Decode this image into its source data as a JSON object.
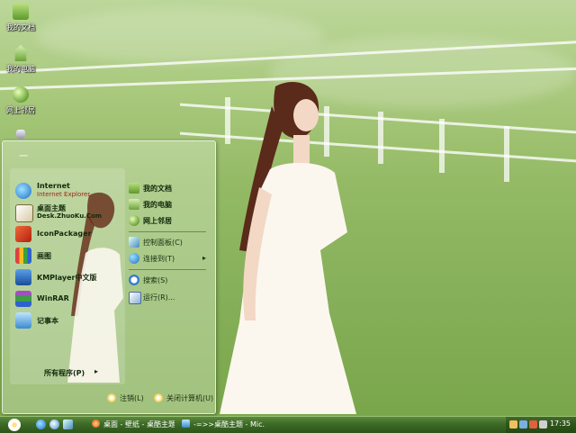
{
  "desktop": {
    "icons": [
      {
        "label": "我的文档",
        "icon": "folder-icon"
      },
      {
        "label": "我的电脑",
        "icon": "home-icon"
      },
      {
        "label": "网上邻居",
        "icon": "globe-icon"
      },
      {
        "label": "",
        "icon": "recycle-bin-icon"
      }
    ]
  },
  "start_menu": {
    "user_name": "一",
    "programs": [
      {
        "title": "Internet",
        "subtitle": "Internet Explorer",
        "icon": "internet-explorer-icon"
      },
      {
        "title": "桌面主题",
        "subtitle": "Desk.ZhuoKu.Com",
        "icon": "desk-theme-icon"
      },
      {
        "title": "IconPackager",
        "subtitle": "",
        "icon": "iconpackager-icon"
      },
      {
        "title": "画图",
        "subtitle": "",
        "icon": "paint-icon"
      },
      {
        "title": "KMPlayer中文版",
        "subtitle": "",
        "icon": "kmplayer-icon"
      },
      {
        "title": "WinRAR",
        "subtitle": "",
        "icon": "winrar-icon"
      },
      {
        "title": "记事本",
        "subtitle": "",
        "icon": "notepad-icon"
      }
    ],
    "all_programs": "所有程序(P)",
    "places": [
      {
        "label": "我的文档",
        "icon": "folder-icon"
      },
      {
        "label": "我的电脑",
        "icon": "home-icon"
      },
      {
        "label": "网上邻居",
        "icon": "globe-icon"
      }
    ],
    "system": [
      {
        "label": "控制面板(C)",
        "icon": "control-panel-icon"
      },
      {
        "label": "连接到(T)",
        "icon": "connect-icon",
        "arrow": "▸"
      }
    ],
    "tools": [
      {
        "label": "搜索(S)",
        "icon": "search-icon"
      },
      {
        "label": "运行(R)...",
        "icon": "run-icon"
      }
    ],
    "power": {
      "logoff": "注销(L)",
      "shutdown": "关闭计算机(U)"
    }
  },
  "taskbar": {
    "quick_launch": [
      "ie-icon",
      "browser-icon",
      "show-desktop-icon"
    ],
    "tasks": [
      {
        "label": "桌面 - 壁纸 - 桌酷主题 ...",
        "icon": "browser-task-icon"
      },
      {
        "label": "-=>>桌酷主题 - Mic...",
        "icon": "window-task-icon"
      }
    ],
    "tray_icons": [
      "volume-icon",
      "network-icon",
      "shield-icon",
      "ime-icon"
    ],
    "clock": "17:35"
  },
  "colors": {
    "accent": "#3d6a26",
    "wallpaper_green": "#86b05a",
    "menu_text": "#132a0c",
    "subtitle_red": "#a3241b"
  }
}
